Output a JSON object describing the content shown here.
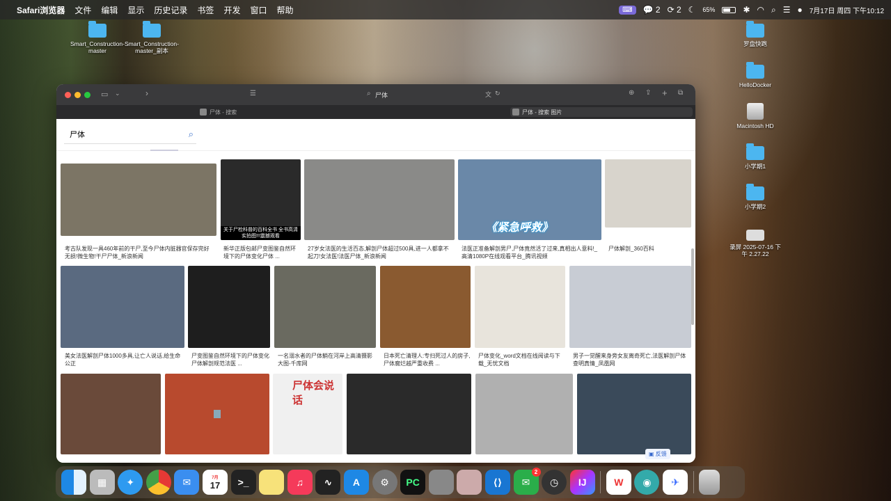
{
  "menubar": {
    "app": "Safari浏览器",
    "items": [
      "文件",
      "编辑",
      "显示",
      "历史记录",
      "书签",
      "开发",
      "窗口",
      "帮助"
    ],
    "status_wechat": "2",
    "status_other": "2",
    "battery": "65%",
    "datetime": "7月17日 周四 下午10:12"
  },
  "desktop": {
    "left_icons": [
      "Smart_Construction-master",
      "Smart_Construction-master_副本"
    ],
    "right_icons": [
      "罗盘快跑",
      "HelloDocker",
      "Macintosh HD",
      "小学期1",
      "小学期2",
      "录屏 2025-07-16 下午 2.27.22"
    ]
  },
  "safari": {
    "address": "尸体",
    "tabs": [
      "尸体 - 搜索",
      "尸体 - 搜索 图片"
    ]
  },
  "search": {
    "value": "尸体"
  },
  "results": [
    {
      "caption": "考古队发现一具460年前的干尸,至今尸体内脏器官保存完好无损!微生物!干尸尸体_新浪新闻",
      "color": "#7c7565"
    },
    {
      "caption": "新华正版包邮尸变图鉴自然环境下的尸体变化尸体 ...",
      "color": "#2a2a2a"
    },
    {
      "caption": "27岁女法医的生活百态,解剖尸体超过500具,进一人都拿不起刀!女法医!法医尸体_新浪新闻",
      "color": "#8a8a88"
    },
    {
      "caption": "法医正准备解剖男尸,尸体竟然活了过来,真相出人意料!_高清1080P在线观看平台_腾讯视频",
      "color": "#6a88a8"
    },
    {
      "caption": "尸体解剖_360百科",
      "color": "#d8d4cc"
    },
    {
      "caption": "美女法医解剖尸体1000多具,让亡人说话,给生命公正",
      "color": "#5a6a80"
    },
    {
      "caption": "尸变图鉴自然环境下的尸体变化尸体解剖规范法医 ...",
      "color": "#1e1e1e"
    },
    {
      "caption": "一名溺水者的尸体躺在河岸上高清摄影大图-千库网",
      "color": "#6a6a60"
    },
    {
      "caption": "日本死亡清理人:专扫死过人的房子,尸体腐烂越严重收费 ...",
      "color": "#8a5a30"
    },
    {
      "caption": "尸体变化_word文档在线阅读与下载_无忧文档",
      "color": "#e8e4dc"
    },
    {
      "caption": "男子一觉醒来身旁女友离奇死亡,法医解剖尸体查明真情_凤凰网",
      "color": "#c8ccd4"
    },
    {
      "caption": "",
      "color": "#6a4a3a"
    },
    {
      "caption": "",
      "color": "#b84a2e"
    },
    {
      "caption": "尸体会说话",
      "color": "#f0f0f0"
    },
    {
      "caption": "",
      "color": "#2a2a2a"
    },
    {
      "caption": "",
      "color": "#b0b0b0"
    },
    {
      "caption": "",
      "color": "#3a4a5a"
    }
  ],
  "book_overlay": "关于尸检科普的百科全书 全书高清实拍图!!!震撼观看",
  "overlay_emergency": "《紧急呼救》",
  "feedback": "反馈",
  "dock": [
    "Finder",
    "Launchpad",
    "Safari",
    "Chrome",
    "Mail",
    "17",
    "Terminal",
    "Notes",
    "Music",
    "Activity",
    "App Store",
    "Settings",
    "PyCharm",
    "Preview",
    "Preview2",
    "VS Code",
    "WeChat",
    "Clock",
    "IntelliJ",
    "WPS",
    "Network",
    "Feishu",
    "Trash"
  ],
  "dock_badge": "2",
  "calendar_month": "7月"
}
